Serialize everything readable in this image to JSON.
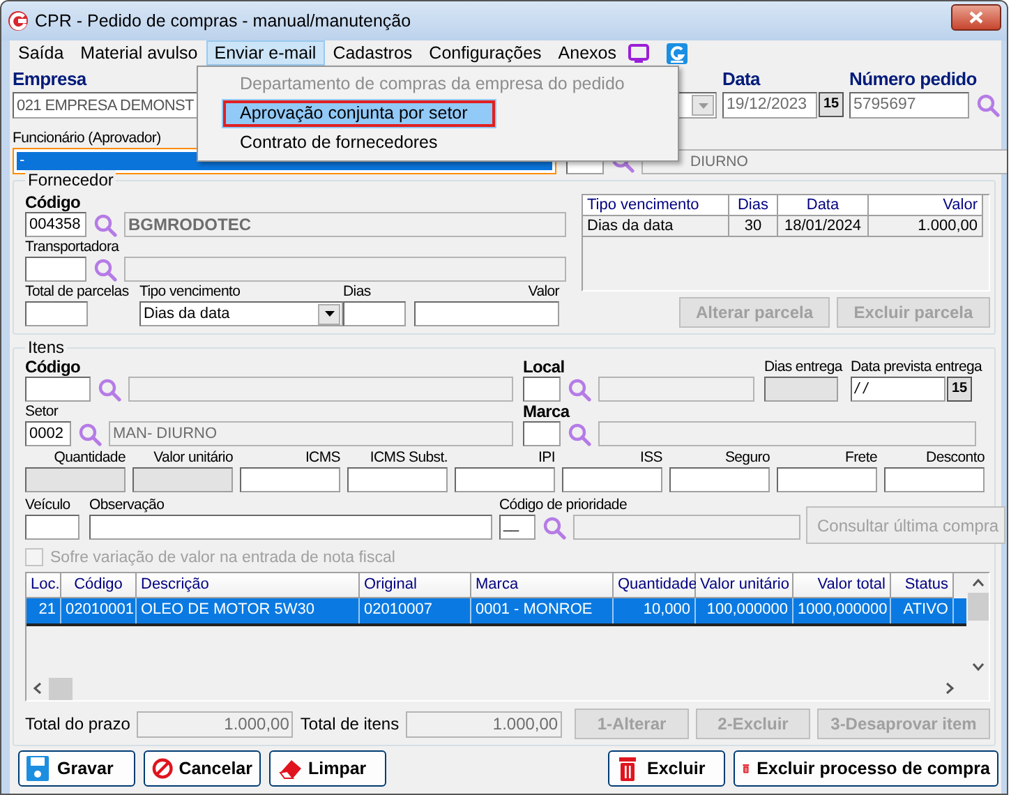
{
  "window": {
    "title": "CPR - Pedido de compras - manual/manutenção"
  },
  "menu": [
    {
      "label": "Saída",
      "open": false
    },
    {
      "label": "Material avulso",
      "open": false
    },
    {
      "label": "Enviar e-mail",
      "open": true
    },
    {
      "label": "Cadastros",
      "open": false
    },
    {
      "label": "Configurações",
      "open": false
    },
    {
      "label": "Anexos",
      "open": false
    }
  ],
  "dropdown": [
    {
      "label": "Departamento de compras da empresa do pedido",
      "disabled": true,
      "selected": false
    },
    {
      "label": "Aprovação conjunta por setor",
      "disabled": false,
      "selected": true
    },
    {
      "label": "Contrato de fornecedores",
      "disabled": false,
      "selected": false
    }
  ],
  "header": {
    "empresa": {
      "label": "Empresa",
      "value": "021 EMPRESA DEMONST"
    },
    "data": {
      "label": "Data",
      "value": "19/12/2023",
      "button": "15"
    },
    "numero": {
      "label": "Número pedido",
      "value": "5795697"
    },
    "funcionario": {
      "label": "Funcionário (Aprovador)",
      "value": "-"
    },
    "setor_nome": "DIURNO"
  },
  "fornecedor": {
    "title": "Fornecedor",
    "codigo": {
      "label": "Código",
      "value": "004358",
      "nome": "BGMRODOTEC"
    },
    "transportadora": {
      "label": "Transportadora"
    },
    "total_parcelas": {
      "label": "Total de parcelas"
    },
    "tipo_vencimento": {
      "label": "Tipo vencimento",
      "value": "Dias da data"
    },
    "dias": {
      "label": "Dias"
    },
    "valor": {
      "label": "Valor"
    },
    "parcelas": {
      "columns": [
        "Tipo vencimento",
        "Dias",
        "Data",
        "Valor"
      ],
      "rows": [
        [
          "Dias da data",
          "30",
          "18/01/2024",
          "1.000,00"
        ]
      ]
    },
    "buttons": [
      {
        "label": "Alterar parcela",
        "disabled": true
      },
      {
        "label": "Excluir parcela",
        "disabled": true
      }
    ]
  },
  "itens": {
    "title": "Itens",
    "codigo": {
      "label": "Código"
    },
    "local": {
      "label": "Local"
    },
    "dias_entrega": {
      "label": "Dias entrega",
      "disabled": true
    },
    "data_prevista": {
      "label": "Data prevista entrega",
      "value": "/ /",
      "button": "15"
    },
    "setor": {
      "label": "Setor",
      "value": "0002",
      "nome": "MAN- DIURNO"
    },
    "marca": {
      "label": "Marca"
    },
    "valores": [
      {
        "label": "Quantidade",
        "disabled": true
      },
      {
        "label": "Valor unitário",
        "disabled": true
      },
      {
        "label": "ICMS",
        "disabled": false
      },
      {
        "label": "ICMS Subst.",
        "disabled": false
      },
      {
        "label": "IPI",
        "disabled": false
      },
      {
        "label": "ISS",
        "disabled": false
      },
      {
        "label": "Seguro",
        "disabled": false
      },
      {
        "label": "Frete",
        "disabled": false
      },
      {
        "label": "Desconto",
        "disabled": false
      }
    ],
    "veiculo": {
      "label": "Veículo"
    },
    "observacao": {
      "label": "Observação"
    },
    "prioridade": {
      "label": "Código de prioridade",
      "value": "__"
    },
    "consultar": {
      "label": "Consultar última compra",
      "disabled": true
    },
    "checkbox": {
      "label": "Sofre variação de valor na entrada de nota fiscal",
      "checked": false,
      "disabled": true
    },
    "grid": {
      "columns": [
        "Loc.",
        "Código",
        "Descrição",
        "Original",
        "Marca",
        "Quantidade",
        "Valor unitário",
        "Valor total",
        "Status"
      ],
      "rows": [
        {
          "cells": [
            "21",
            "02010001",
            "OLEO DE MOTOR 5W30",
            "02010007",
            "0001 - MONROE",
            "10,000",
            "100,000000",
            "1000,000000",
            "ATIVO"
          ],
          "selected": true
        }
      ]
    },
    "totais": [
      {
        "label": "Total do prazo",
        "value": "1.000,00"
      },
      {
        "label": "Total de itens",
        "value": "1.000,00"
      }
    ],
    "buttons": [
      {
        "label": "1-Alterar",
        "disabled": true
      },
      {
        "label": "2-Excluir",
        "disabled": true
      },
      {
        "label": "3-Desaprovar item",
        "disabled": true
      }
    ]
  },
  "buttons": [
    {
      "label": "Gravar",
      "kind": "save"
    },
    {
      "label": "Cancelar",
      "kind": "cancel"
    },
    {
      "label": "Limpar",
      "kind": "clear"
    },
    {
      "label": "Excluir",
      "kind": "delete"
    },
    {
      "label": "Excluir processo de compra",
      "kind": "delete"
    }
  ]
}
